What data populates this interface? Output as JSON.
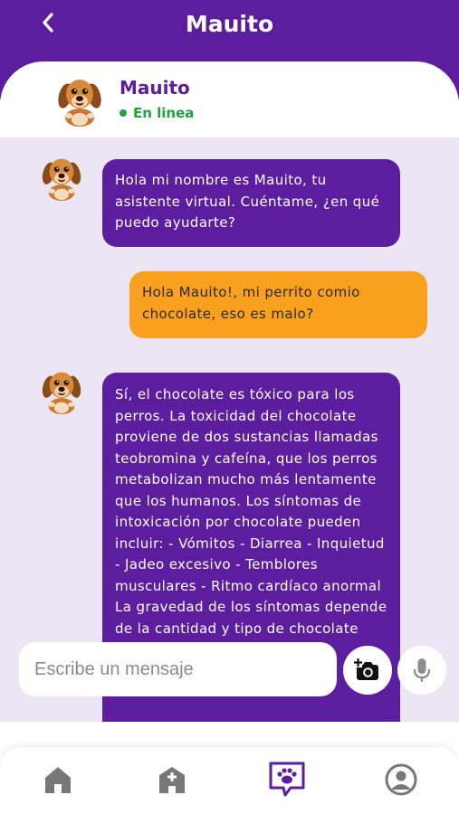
{
  "header": {
    "title": "Mauito",
    "back_icon": "chevron-left-icon"
  },
  "contact": {
    "name": "Mauito",
    "status": "En linea",
    "avatar": "dog-avatar"
  },
  "messages": [
    {
      "sender": "bot",
      "text": "Hola mi nombre es Mauito, tu asistente virtual. Cuéntame, ¿en qué puedo ayudarte?"
    },
    {
      "sender": "user",
      "text": "Hola Mauito!, mi perrito comio chocolate, eso es malo?"
    },
    {
      "sender": "bot",
      "text": "Sí, el chocolate es tóxico para los perros. La toxicidad del chocolate proviene de dos sustancias llamadas teobromina y cafeína, que los perros metabolizan mucho más lentamente que los humanos. Los síntomas de intoxicación por chocolate pueden incluir: - Vómitos - Diarrea - Inquietud - Jadeo excesivo - Temblores musculares - Ritmo cardíaco anormal La gravedad de los síntomas depende de la cantidad y tipo de chocolate"
    }
  ],
  "composer": {
    "placeholder": "Escribe un mensaje",
    "camera_icon": "camera-add-icon",
    "mic_icon": "microphone-icon"
  },
  "nav": [
    {
      "icon": "home-icon",
      "active": false
    },
    {
      "icon": "hospital-icon",
      "active": false
    },
    {
      "icon": "paw-chat-icon",
      "active": true
    },
    {
      "icon": "profile-icon",
      "active": false
    }
  ],
  "colors": {
    "primary": "#5c1d9f",
    "user_bubble": "#f9a01e",
    "chat_bg": "#ece6f4",
    "online": "#1fa33b"
  }
}
